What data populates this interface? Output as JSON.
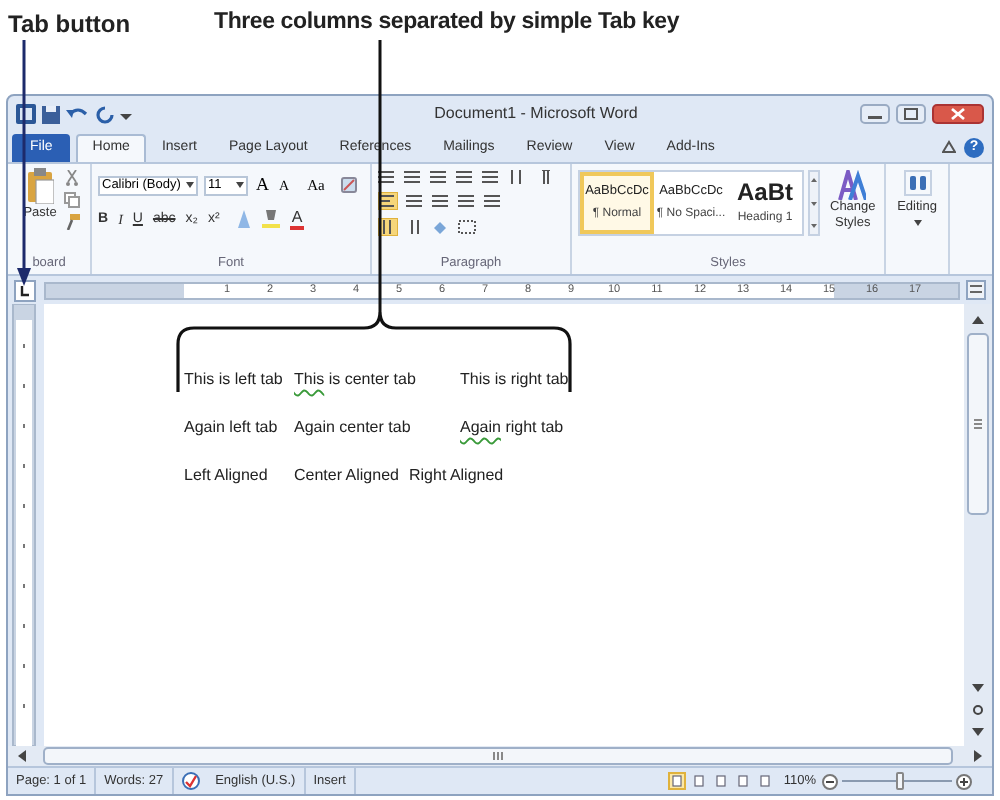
{
  "annotations": [
    {
      "text": "Tab button"
    },
    {
      "text": "Three columns separated by simple Tab key"
    }
  ],
  "window": {
    "title": "Document1 - Microsoft Word"
  },
  "ribbon_tabs": [
    {
      "label": "File",
      "kind": "file"
    },
    {
      "label": "Home",
      "kind": "tab",
      "selected": true
    },
    {
      "label": "Insert",
      "kind": "tab",
      "selected": false
    },
    {
      "label": "Page Layout",
      "kind": "tab",
      "selected": false
    },
    {
      "label": "References",
      "kind": "tab",
      "selected": false
    },
    {
      "label": "Mailings",
      "kind": "tab",
      "selected": false
    },
    {
      "label": "Review",
      "kind": "tab",
      "selected": false
    },
    {
      "label": "View",
      "kind": "tab",
      "selected": false
    },
    {
      "label": "Add-Ins",
      "kind": "tab",
      "selected": false
    }
  ],
  "help": "?",
  "clipboard": {
    "paste": "Paste",
    "label": "board"
  },
  "font": {
    "name": "Calibri (Body)",
    "size": "11",
    "grow": "A",
    "shrink": "A",
    "change_case": "Aa",
    "format_buttons": [
      "B",
      "I",
      "U",
      "abc",
      "x₂",
      "x²"
    ],
    "font_color": "A",
    "label": "Font"
  },
  "paragraph": {
    "label": "Paragraph"
  },
  "styles": {
    "items": [
      {
        "preview": "AaBbCcDc",
        "name": "¶ Normal",
        "kind": "small",
        "selected": true
      },
      {
        "preview": "AaBbCcDc",
        "name": "¶ No Spaci...",
        "kind": "small",
        "selected": false
      },
      {
        "preview": "AaBt",
        "name": "Heading 1",
        "kind": "large",
        "selected": false
      }
    ],
    "change_styles": [
      "Change",
      "Styles"
    ],
    "label": "Styles"
  },
  "editing": "Editing",
  "ruler": {
    "labels": [
      "1",
      "2",
      "3",
      "4",
      "5",
      "6",
      "7",
      "8",
      "9",
      "10",
      "11",
      "12",
      "13",
      "14",
      "15",
      "16",
      "17"
    ]
  },
  "document": {
    "lines": [
      {
        "kind": "tabbed",
        "cells": [
          {
            "text": "This is left tab",
            "flagged": false
          },
          {
            "text": "This is center tab",
            "flagged": true
          },
          {
            "text": "This is right tab",
            "flagged": false
          }
        ]
      },
      {
        "kind": "tabbed",
        "cells": [
          {
            "text": "Again left tab",
            "flagged": false
          },
          {
            "text": "Again center tab",
            "flagged": false
          },
          {
            "text": "Again right tab",
            "flagged": true
          }
        ]
      },
      {
        "kind": "plain",
        "cells": [
          {
            "text": "Left Aligned",
            "flagged": false
          },
          {
            "text": "Center Aligned",
            "flagged": false
          },
          {
            "text": "Right Aligned",
            "flagged": false
          }
        ]
      }
    ]
  },
  "status_bar": {
    "page": "Page: 1 of 1",
    "words": "Words: 27",
    "language": "English (U.S.)",
    "mode": "Insert",
    "views": [
      {
        "selected": true
      },
      {
        "selected": false
      },
      {
        "selected": false
      },
      {
        "selected": false
      },
      {
        "selected": false
      }
    ],
    "zoom": "110%",
    "zoom_slider": {
      "level": 0.52
    }
  }
}
